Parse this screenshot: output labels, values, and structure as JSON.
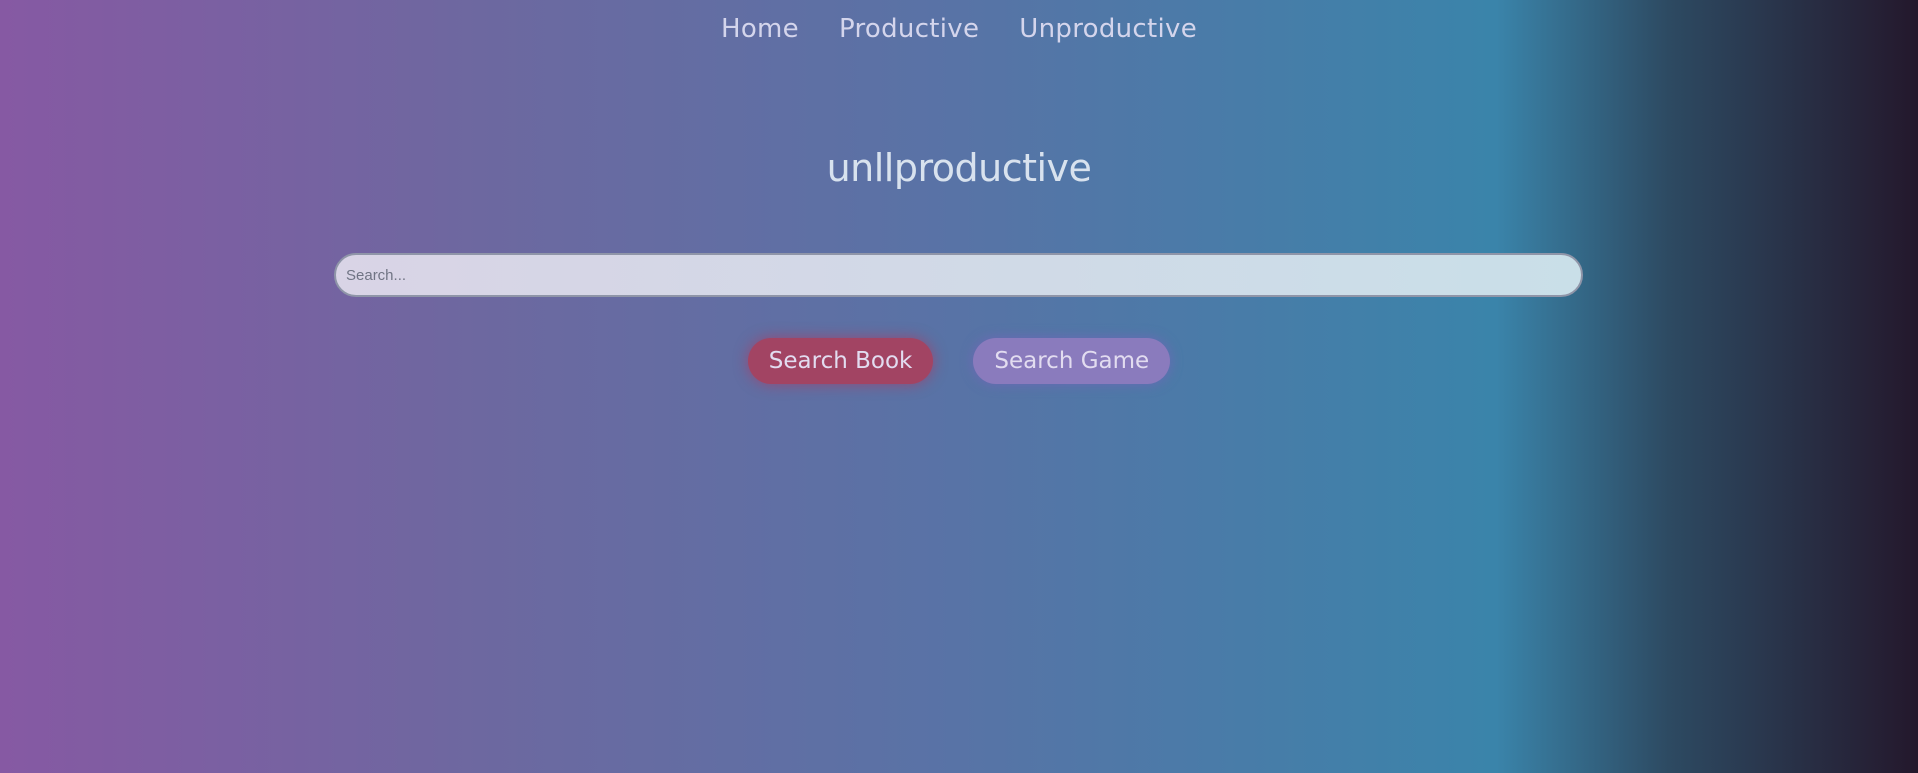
{
  "nav": {
    "items": [
      {
        "label": "Home"
      },
      {
        "label": "Productive"
      },
      {
        "label": "Unproductive"
      }
    ]
  },
  "logo": {
    "text": "unllproductive"
  },
  "search": {
    "value": "",
    "placeholder": "Search..."
  },
  "buttons": {
    "book_label": "Search Book",
    "game_label": "Search Game"
  },
  "colors": {
    "book_button": "#a24463",
    "game_button": "#8a7bbd"
  }
}
